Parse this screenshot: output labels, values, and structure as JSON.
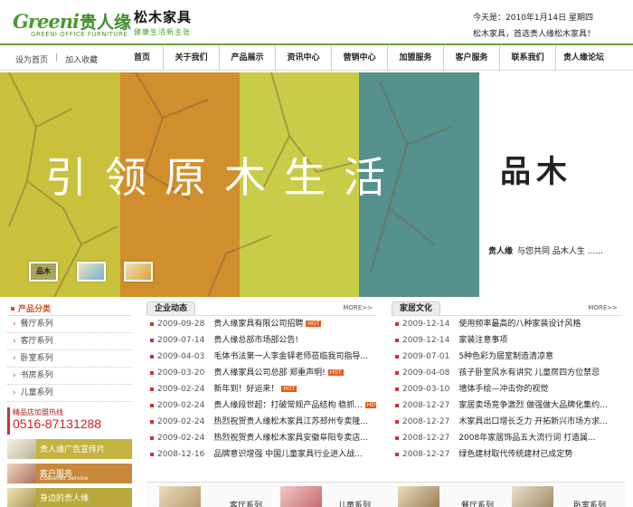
{
  "header": {
    "logo_text": "Greeni",
    "logo_cn": "贵人缘",
    "logo_tm": "GREENI OFFICE FURNITURE",
    "brand_name": "松木家具",
    "brand_tagline": "健康生活新主张",
    "date_line": "今天是：2010年1月14日 星期四",
    "slogan": "松木家具，首选贵人缘松木家具！"
  },
  "nav": {
    "util": [
      "设为首页",
      "加入收藏"
    ],
    "items": [
      "首页",
      "关于我们",
      "产品展示",
      "资讯中心",
      "营销中心",
      "加盟服务",
      "客户服务",
      "联系我们",
      "贵人缘论坛"
    ]
  },
  "banner": {
    "headline": "引领原木生活",
    "brand_mark": "品木",
    "seal": "贵人缘",
    "tagline": "与您共同 品木人生 ......",
    "thumb1": "品木"
  },
  "colors": {
    "nav_rule": "#6aa23a",
    "stripe1": "#c9c13b",
    "stripe2": "#d08e2c",
    "stripe3": "#c8cc47",
    "stripe4": "#54908c",
    "accent_red": "#cc3333"
  },
  "categories": {
    "title": "产品分类",
    "items": [
      "餐厅系列",
      "客厅系列",
      "卧室系列",
      "书房系列",
      "儿童系列"
    ]
  },
  "hotline": {
    "label": "精品店加盟热线",
    "number": "0516-87131288"
  },
  "promos": [
    {
      "title": "贵人缘广告宣传片",
      "sub": ""
    },
    {
      "title": "客户服务",
      "sub": "Customer Service"
    },
    {
      "title": "身边的贵人缘",
      "sub": ""
    }
  ],
  "news": {
    "title": "企业动态",
    "more": "MORE>>",
    "rows": [
      {
        "date": "2009-09-28",
        "title": "贵人缘家具有限公司招聘",
        "hot": "HOT"
      },
      {
        "date": "2009-07-14",
        "title": "贵人缘总部市场部公告!",
        "hot": ""
      },
      {
        "date": "2009-04-03",
        "title": "毛体书法第一人李金铎老师莅临我司指导...",
        "hot": ""
      },
      {
        "date": "2009-03-20",
        "title": "贵人缘家具公司总部 郑重声明!",
        "hot": "HOT"
      },
      {
        "date": "2009-02-24",
        "title": "新年到！好运来！",
        "hot": "HOT"
      },
      {
        "date": "2009-02-24",
        "title": "贵人缘段世超：打破常规产品结构 稳抓...",
        "hot": "HOT"
      },
      {
        "date": "2009-02-24",
        "title": "热烈祝贺贵人缘松木家具江苏邳州专卖隆...",
        "hot": ""
      },
      {
        "date": "2009-02-24",
        "title": "热烈祝贺贵人缘松木家具安徽阜阳专卖店...",
        "hot": ""
      },
      {
        "date": "2008-12-16",
        "title": "品牌意识增强 中国儿童家具行业进入战...",
        "hot": ""
      }
    ]
  },
  "home_culture": {
    "title": "家居文化",
    "more": "MORE>>",
    "rows": [
      {
        "date": "2009-12-14",
        "title": "使用频率最高的八种家装设计风格"
      },
      {
        "date": "2009-12-14",
        "title": "家装注意事项"
      },
      {
        "date": "2009-07-01",
        "title": "5种色彩为居室制造清凉意"
      },
      {
        "date": "2009-04-08",
        "title": "孩子卧室风水有讲究 儿童房四方位禁忌"
      },
      {
        "date": "2009-03-10",
        "title": "墙体手绘—冲击你的视觉"
      },
      {
        "date": "2008-12-27",
        "title": "家居卖场竞争激烈 做强做大品牌化集约..."
      },
      {
        "date": "2008-12-27",
        "title": "木家具出口增长乏力 开拓新兴市场方求..."
      },
      {
        "date": "2008-12-27",
        "title": "2008年家居饰品五大流行词 打造属..."
      },
      {
        "date": "2008-12-27",
        "title": "绿色建材取代传统建材已成定势"
      }
    ]
  },
  "gallery": [
    "客厅系列",
    "儿童系列",
    "餐厅系列",
    "卧室系列"
  ]
}
